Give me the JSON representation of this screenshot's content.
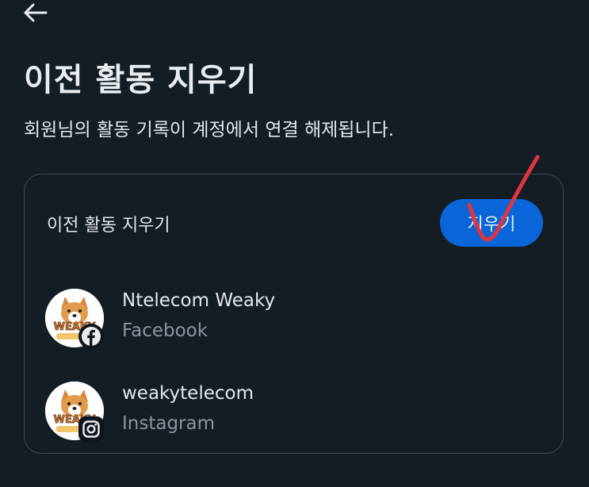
{
  "header": {
    "back_icon": "arrow-left-icon",
    "title": "이전 활동 지우기",
    "subtitle": "회원님의 활동 기록이 계정에서 연결 해제됩니다."
  },
  "card": {
    "title": "이전 활동 지우기",
    "button_label": "지우기",
    "accounts": [
      {
        "name": "Ntelecom Weaky",
        "platform": "Facebook",
        "badge_icon": "facebook-icon"
      },
      {
        "name": "weakytelecom",
        "platform": "Instagram",
        "badge_icon": "instagram-icon"
      }
    ]
  },
  "avatar_logo_text": "WEAKY",
  "colors": {
    "background": "#141d24",
    "card_border": "#3d4a55",
    "button": "#0a66d8",
    "secondary_text": "#8a959f",
    "annotation_check": "#e2343f"
  }
}
